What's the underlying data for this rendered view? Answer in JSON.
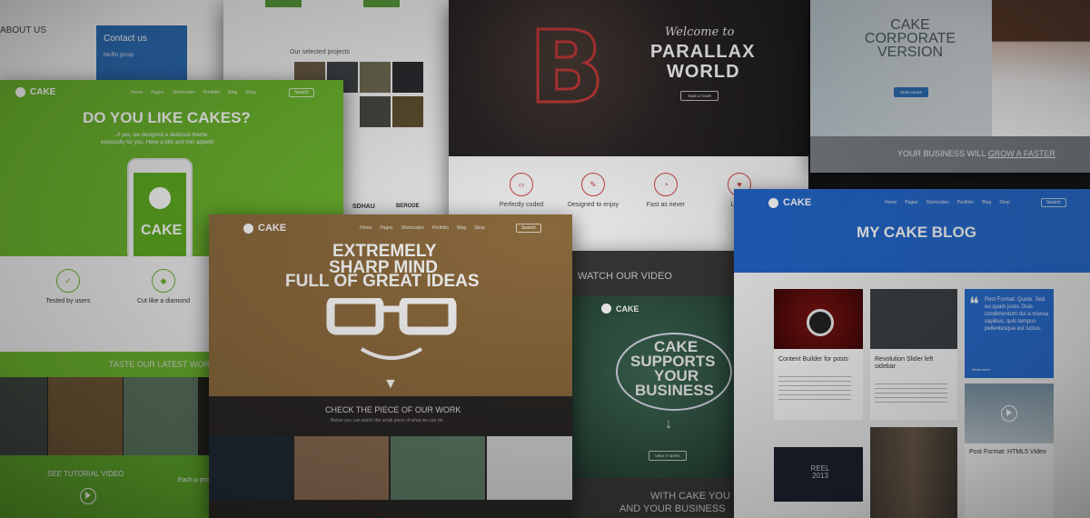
{
  "nav": {
    "links": [
      "Home",
      "Pages",
      "Shortcodes",
      "Portfolio",
      "Blog",
      "Shop"
    ],
    "search": "Search"
  },
  "top_left": {
    "about": "ABOUT US",
    "contact": "Contact us",
    "group": "Muffin group",
    "projects": "Our selected projects",
    "brand_a": "SDHAU",
    "brand_b": "BERODE"
  },
  "green": {
    "logo": "CAKE",
    "headline": "DO YOU LIKE CAKES?",
    "sub1": "...if yes, we designed a delicious theme",
    "sub2": "especially for you. Have a bite and bon appetit!",
    "phone_label": "CAKE",
    "feat1": "Tested by users",
    "feat2": "Cut like a diamond",
    "latest": "TASTE OUR LATEST WORK",
    "video": "SEE TUTORIAL VIDEO",
    "quote": "Each p proper"
  },
  "parallax": {
    "welcome": "Welcome to",
    "title1": "PARALLAX",
    "title2": "WORLD",
    "button": "TAKE A TOUR",
    "letter": "B",
    "features": [
      "Perfectly coded",
      "Designed to enjoy",
      "Fast as never",
      "Loved"
    ],
    "watch": "WATCH OUR VIDEO"
  },
  "corporate": {
    "title": "CAKE CORPORATE VERSION",
    "button": "READ MORE",
    "tagline_a": "YOUR BUSINESS WILL ",
    "tagline_b": "GROW A FASTER"
  },
  "brown": {
    "logo": "CAKE",
    "head1": "EXTREMELY",
    "head2": "SHARP MIND",
    "head3": "FULL OF GREAT IDEAS",
    "check": "CHECK THE PIECE OF OUR WORK",
    "check_sub": "Below you can watch the small piece of what we can do"
  },
  "chalk": {
    "logo": "CAKE",
    "line1": "CAKE",
    "line2": "SUPPORTS",
    "line3": "YOUR",
    "line4": "BUSINESS",
    "button": "VIEW IT MORE",
    "footer1": "WITH CAKE YOU",
    "footer2": "AND YOUR BUSINESS"
  },
  "blog": {
    "logo": "CAKE",
    "title": "MY CAKE BLOG",
    "post1_title": "Content Builder for posts",
    "post2_title": "Revolution Slider left sidebar",
    "quote1": "Post Format: Quote. Sed eu quam justo. Duis condimentum dui a massa sapibus, quis tempus pellentesque est luctus.",
    "post3_title": "Post Format: HTML5 Video",
    "read_more": "Read more",
    "reel": "REEL 2013"
  }
}
